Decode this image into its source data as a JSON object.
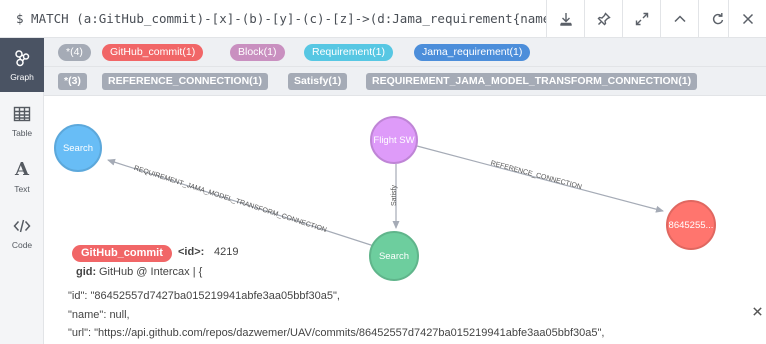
{
  "query": {
    "text": "$ MATCH (a:GitHub_commit)-[x]-(b)-[y]-(c)-[z]->(d:Jama_requirement{name:"
  },
  "toolbar": {
    "download_icon": "download-icon",
    "pin_icon": "pin-icon",
    "expand_icon": "expand-icon",
    "collapse_icon": "chevron-up-icon",
    "rerun_icon": "refresh-icon",
    "close_icon": "close-icon"
  },
  "sidenav": {
    "items": [
      {
        "label": "Graph",
        "icon": "graph-icon",
        "active": true
      },
      {
        "label": "Table",
        "icon": "table-icon",
        "active": false
      },
      {
        "label": "Text",
        "icon": "text-icon",
        "glyph": "A",
        "active": false
      },
      {
        "label": "Code",
        "icon": "code-icon",
        "active": false
      }
    ]
  },
  "node_labels": [
    {
      "label": "*(4)",
      "color": "#a5abb6",
      "text_color": "#ffffff"
    },
    {
      "label": "GitHub_commit(1)",
      "color": "#f16667",
      "text_color": "#ffffff"
    },
    {
      "label": "Block(1)",
      "color": "#c990c0",
      "text_color": "#ffffff"
    },
    {
      "label": "Requirement(1)",
      "color": "#57c7e3",
      "text_color": "#ffffff"
    },
    {
      "label": "Jama_requirement(1)",
      "color": "#4c8eda",
      "text_color": "#ffffff"
    }
  ],
  "relationship_types": [
    {
      "label": "*(3)"
    },
    {
      "label": "REFERENCE_CONNECTION(1)"
    },
    {
      "label": "Satisfy(1)"
    },
    {
      "label": "REQUIREMENT_JAMA_MODEL_TRANSFORM_CONNECTION(1)"
    }
  ],
  "graph": {
    "nodes": [
      {
        "caption": "Search",
        "color": "#68bdf6",
        "border": "#5ca8db"
      },
      {
        "caption": "Flight SW",
        "color": "#de9bf9",
        "border": "#bf85d6"
      },
      {
        "caption": "Search",
        "color": "#6dce9e",
        "border": "#60b58b"
      },
      {
        "caption": "8645255...",
        "color": "#ff756e",
        "border": "#e06760"
      }
    ],
    "relationships": [
      {
        "label": "REQUIREMENT_JAMA_MODEL_TRANSFORM_CONNECTION"
      },
      {
        "label": "REFERENCE_CONNECTION"
      },
      {
        "label": "Satisfy"
      }
    ]
  },
  "inspector": {
    "label": "GitHub_commit",
    "id_label": "<id>:",
    "id_value": "4219",
    "gid_label": "gid:",
    "gid_value": "GitHub @ Intercax | {",
    "lines": [
      "\"id\": \"86452557d7427ba015219941abfe3aa05bbf30a5\",",
      "\"name\": null,",
      "\"url\": \"https://api.github.com/repos/dazwemer/UAV/commits/86452557d7427ba015219941abfe3aa05bbf30a5\","
    ],
    "close_icon": "close-icon"
  }
}
